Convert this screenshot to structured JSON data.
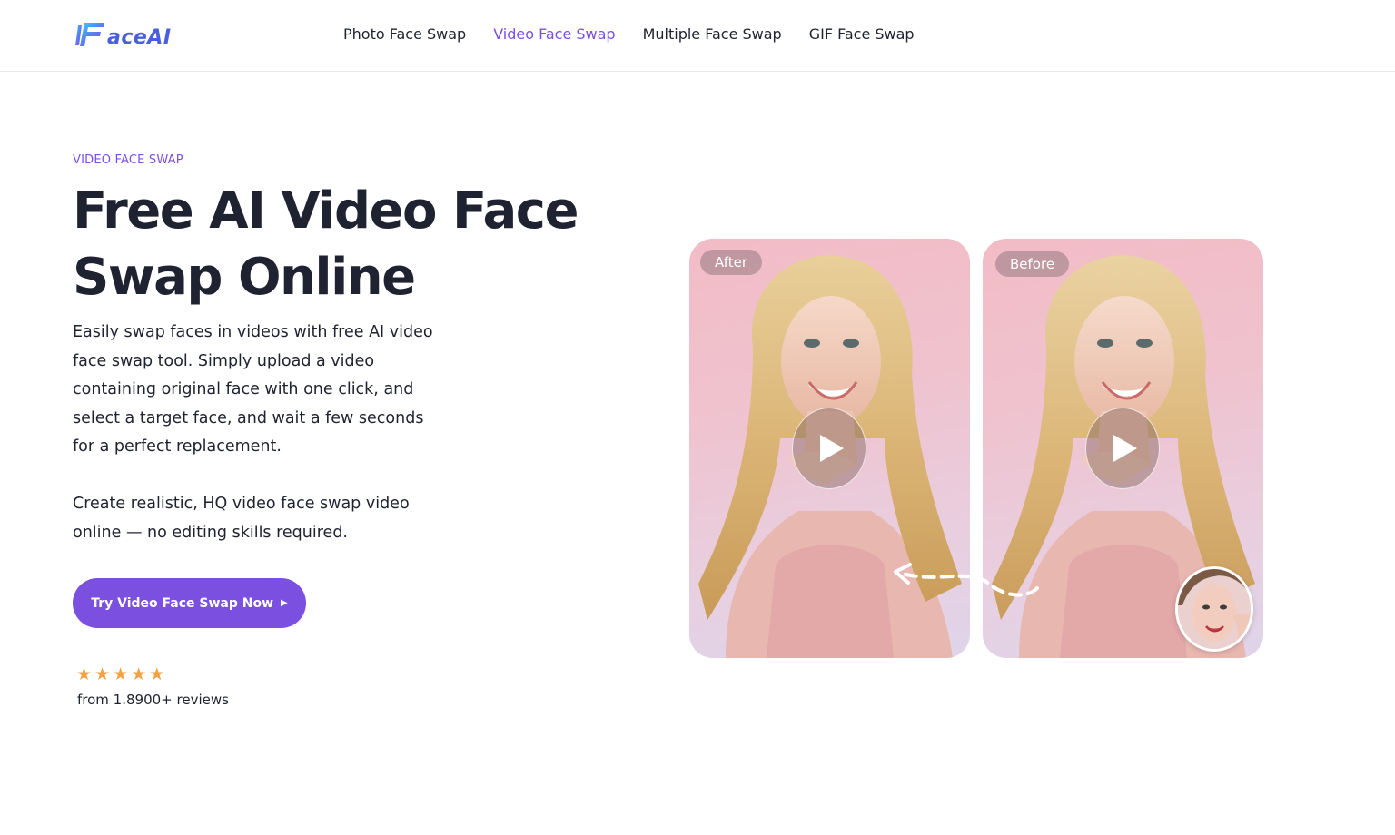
{
  "header": {
    "logo_text": "aceAI",
    "nav": [
      {
        "label": "Photo Face Swap",
        "active": false
      },
      {
        "label": "Video Face Swap",
        "active": true
      },
      {
        "label": "Multiple Face Swap",
        "active": false
      },
      {
        "label": "GIF Face Swap",
        "active": false
      }
    ]
  },
  "hero": {
    "eyebrow": "VIDEO FACE SWAP",
    "title": "Free AI Video Face Swap Online",
    "description": "Easily swap faces in videos with free AI video face swap tool. Simply upload a video containing original face with one click, and select a target face, and wait a few seconds for a perfect replacement.",
    "description2": "Create realistic, HQ video face swap video online — no editing skills required.",
    "cta_label": "Try Video Face Swap Now",
    "rating": 5,
    "reviews_text": "from 1.8900+ reviews"
  },
  "preview": {
    "after_label": "After",
    "before_label": "Before"
  },
  "colors": {
    "accent": "#7b4fe0",
    "star": "#f2a144",
    "text": "#1f2230"
  },
  "icons": {
    "logo": "faceai-logo-icon",
    "play": "play-icon",
    "star": "star-icon",
    "caret": "caret-right-icon",
    "arrow": "dashed-arrow-icon"
  }
}
